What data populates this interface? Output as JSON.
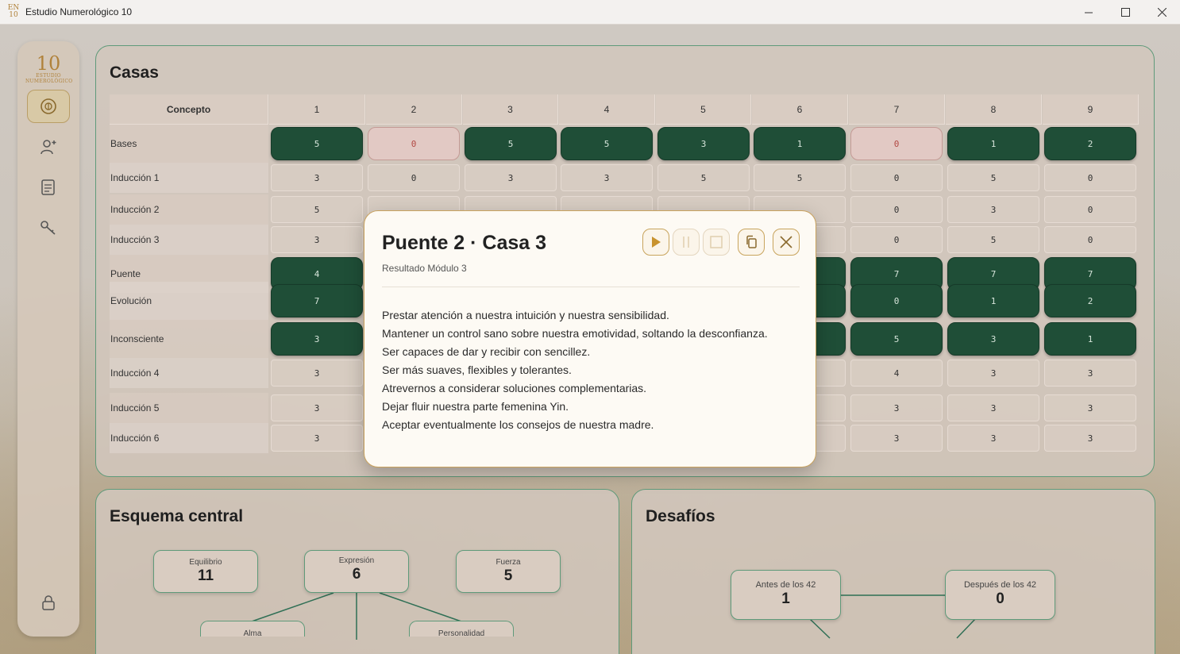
{
  "window": {
    "title": "Estudio Numerológico 10",
    "icon_text_top": "EN",
    "icon_text_bottom": "10"
  },
  "sidebar": {
    "logo": {
      "number": "10",
      "line1": "ESTUDIO",
      "line2": "NUMEROLÓGICO"
    },
    "items": [
      {
        "name": "home",
        "icon": "emblem-icon",
        "active": true
      },
      {
        "name": "person",
        "icon": "user-add-icon",
        "active": false
      },
      {
        "name": "document",
        "icon": "document-icon",
        "active": false
      },
      {
        "name": "key",
        "icon": "key-icon",
        "active": false
      },
      {
        "name": "lock",
        "icon": "lock-icon",
        "active": false
      }
    ]
  },
  "casas": {
    "title": "Casas",
    "header": [
      "Concepto",
      "1",
      "2",
      "3",
      "4",
      "5",
      "6",
      "7",
      "8",
      "9"
    ],
    "rows": [
      {
        "label": "Bases",
        "style": "highlight",
        "values": [
          "5",
          "0",
          "5",
          "5",
          "3",
          "1",
          "0",
          "1",
          "2"
        ],
        "zero_style": "pink"
      },
      {
        "label": "Inducción 1",
        "style": "plain",
        "values": [
          "3",
          "0",
          "3",
          "3",
          "5",
          "5",
          "0",
          "5",
          "0"
        ]
      },
      {
        "label": "Inducción 2",
        "style": "plain",
        "values": [
          "5",
          "",
          "",
          "",
          "",
          "",
          "0",
          "3",
          "0"
        ]
      },
      {
        "label": "Inducción 3",
        "style": "plain",
        "values": [
          "3",
          "",
          "",
          "",
          "",
          "",
          "0",
          "5",
          "0"
        ]
      },
      {
        "label": "Puente",
        "style": "highlight",
        "values": [
          "4",
          "",
          "",
          "",
          "",
          "",
          "7",
          "7",
          "7"
        ]
      },
      {
        "label": "Evolución",
        "style": "highlight",
        "values": [
          "7",
          "",
          "",
          "",
          "",
          "",
          "0",
          "1",
          "2"
        ]
      },
      {
        "label": "Inconsciente",
        "style": "highlight",
        "values": [
          "3",
          "",
          "",
          "",
          "",
          "",
          "5",
          "3",
          "1"
        ]
      },
      {
        "label": "Inducción 4",
        "style": "plain",
        "values": [
          "3",
          "",
          "",
          "",
          "",
          "",
          "4",
          "3",
          "3"
        ]
      },
      {
        "label": "Inducción 5",
        "style": "plain",
        "values": [
          "3",
          "",
          "",
          "",
          "",
          "",
          "3",
          "3",
          "3"
        ]
      },
      {
        "label": "Inducción 6",
        "style": "plain",
        "values": [
          "3",
          "",
          "",
          "",
          "",
          "",
          "3",
          "3",
          "3"
        ]
      }
    ]
  },
  "modal": {
    "title": "Puente 2 · Casa 3",
    "subtitle": "Resultado Módulo 3",
    "lines": [
      "Prestar atención a nuestra intuición y nuestra sensibilidad.",
      "Mantener un control sano sobre nuestra emotividad, soltando la desconfianza.",
      "Ser capaces de dar y recibir con sencillez.",
      "Ser más suaves, flexibles y tolerantes.",
      "Atrevernos a considerar soluciones complementarias.",
      "Dejar fluir nuestra parte femenina Yin.",
      "Aceptar eventualmente los consejos de nuestra madre."
    ],
    "buttons": [
      {
        "name": "play-button",
        "icon": "play-icon",
        "enabled": true
      },
      {
        "name": "pause-button",
        "icon": "pause-icon",
        "enabled": false
      },
      {
        "name": "stop-button",
        "icon": "stop-icon",
        "enabled": false
      },
      {
        "name": "copy-button",
        "icon": "copy-icon",
        "enabled": true
      },
      {
        "name": "close-button",
        "icon": "close-icon",
        "enabled": true
      }
    ]
  },
  "esquema": {
    "title": "Esquema central",
    "nodes": {
      "equilibrio": {
        "label": "Equilibrio",
        "value": "11"
      },
      "expresion": {
        "label": "Expresión",
        "value": "6"
      },
      "fuerza": {
        "label": "Fuerza",
        "value": "5"
      },
      "alma": {
        "label": "Alma",
        "value": ""
      },
      "personalidad": {
        "label": "Personalidad",
        "value": ""
      }
    }
  },
  "desafios": {
    "title": "Desafíos",
    "nodes": {
      "antes": {
        "label": "Antes de los 42",
        "value": "1"
      },
      "despues": {
        "label": "Después de los 42",
        "value": "0"
      }
    }
  },
  "colors": {
    "accent_green": "#1f4e37",
    "accent_gold": "#b0823b",
    "zero_pink": "#e2c9c4",
    "panel_border": "#5f9a7a"
  }
}
